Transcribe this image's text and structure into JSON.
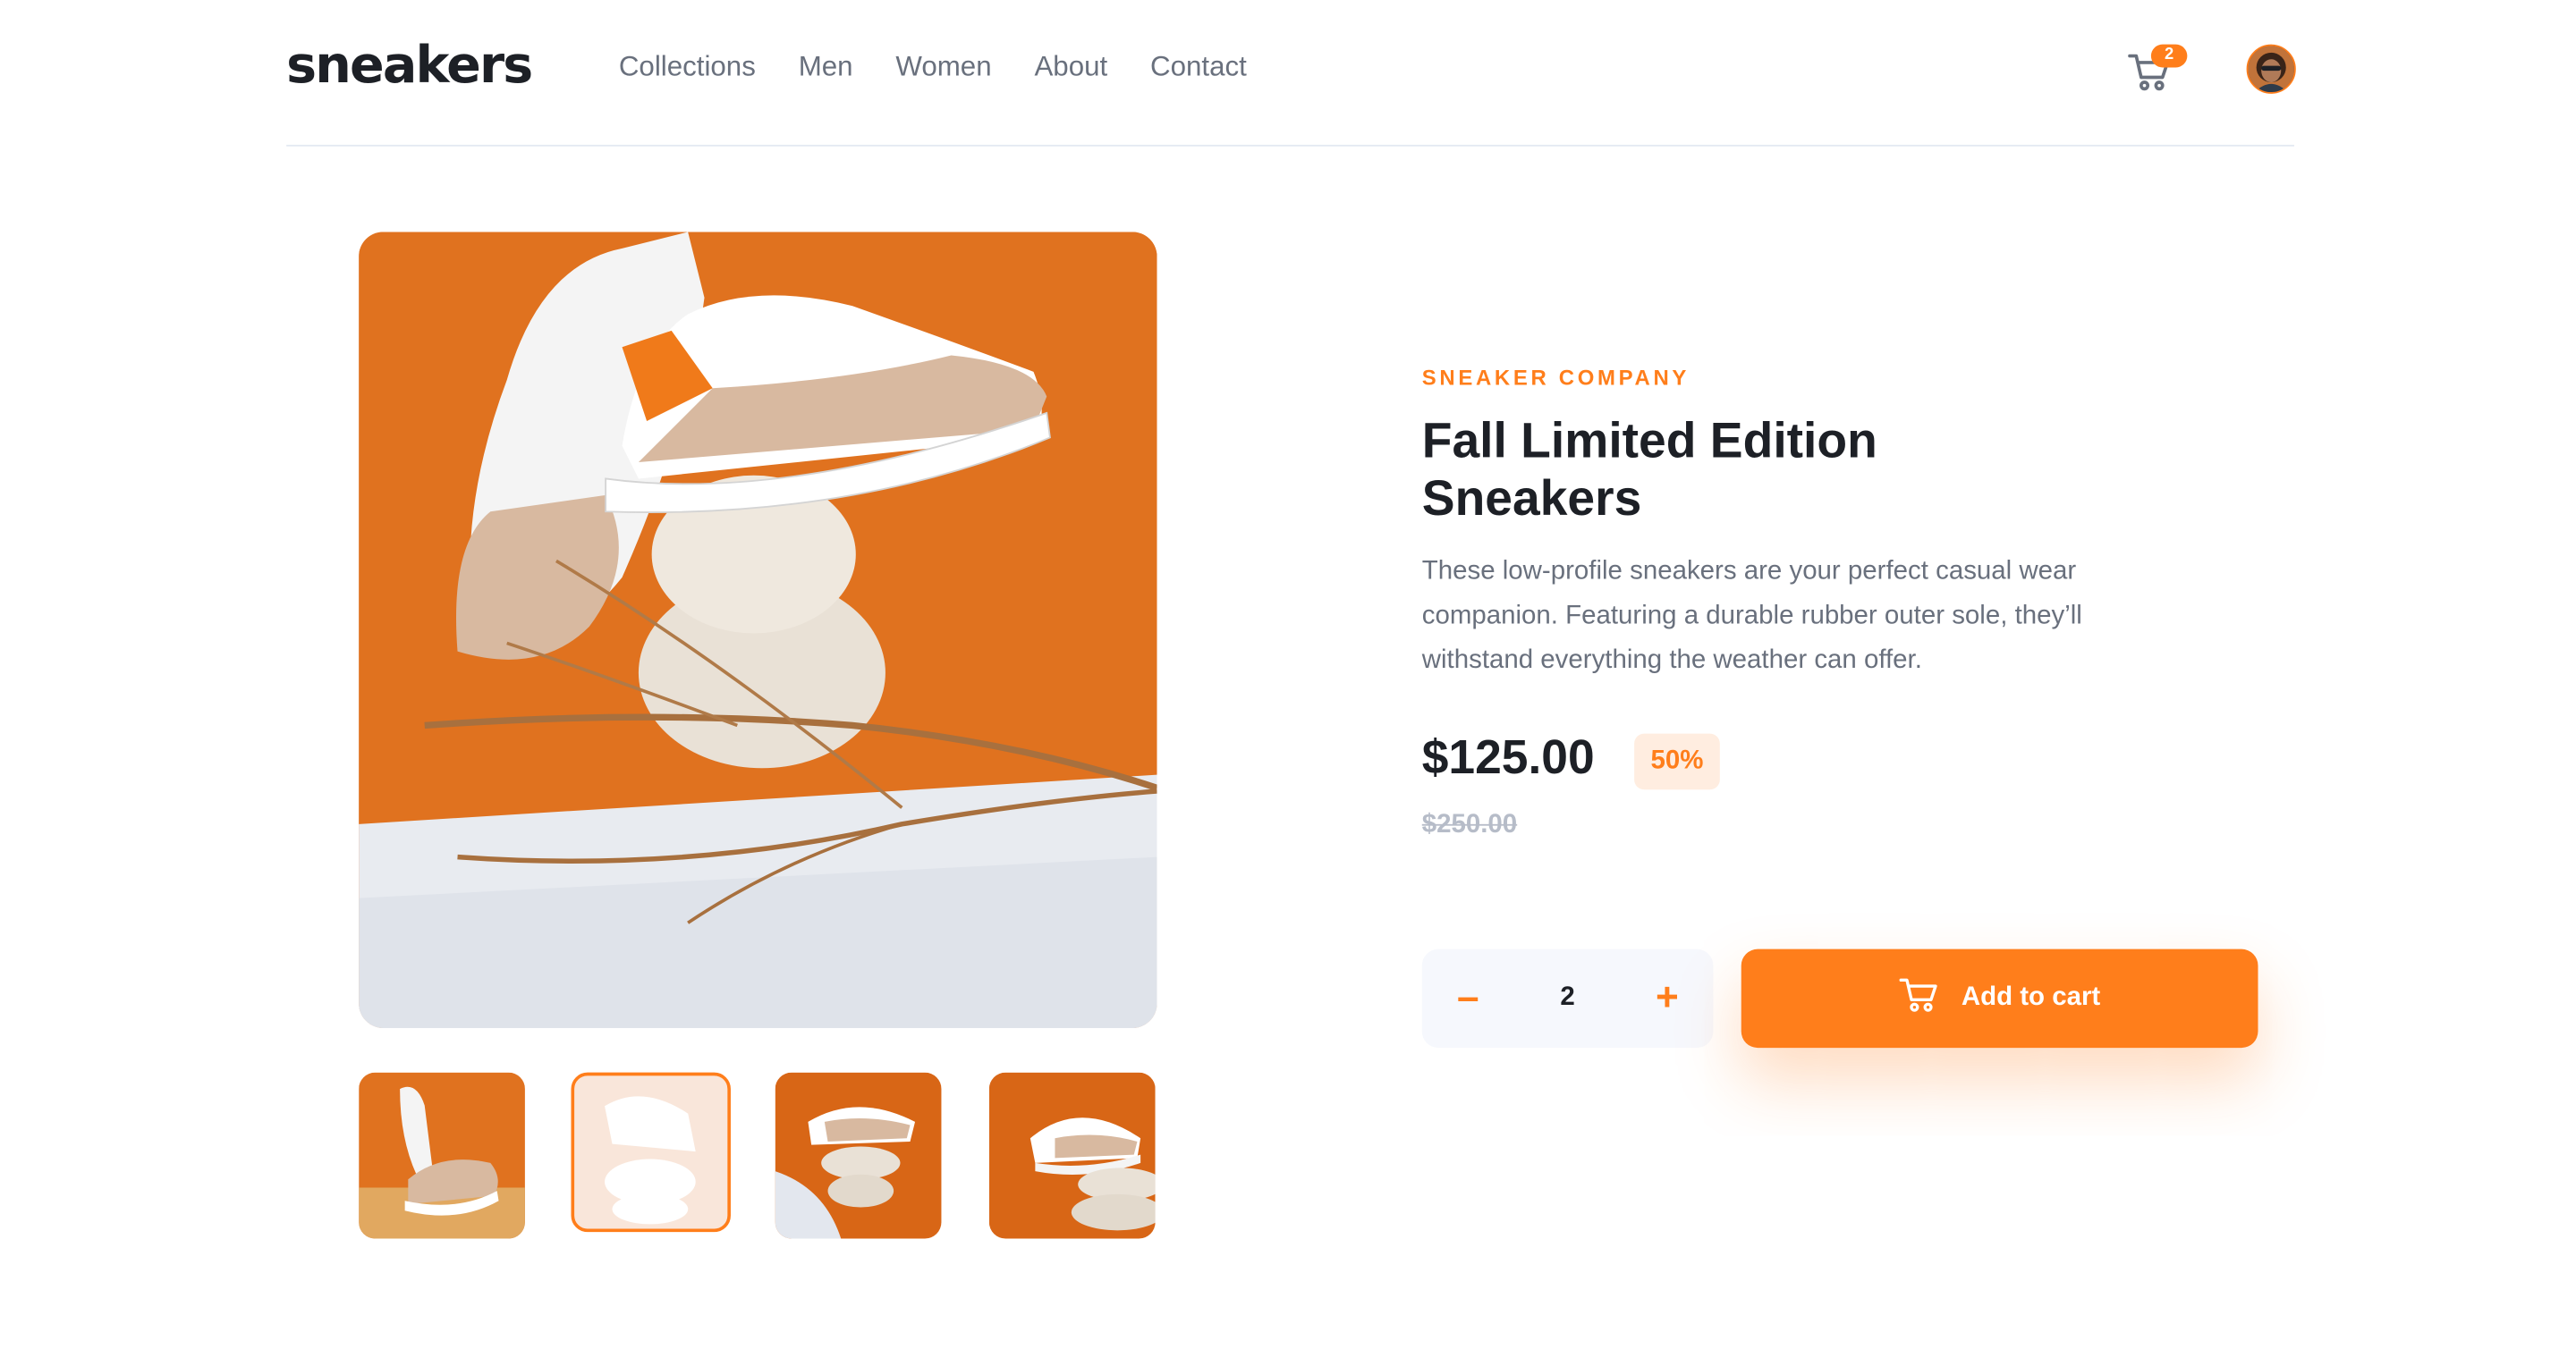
{
  "header": {
    "logo": "sneakers",
    "nav": [
      "Collections",
      "Men",
      "Women",
      "About",
      "Contact"
    ],
    "cart_count": "2",
    "icons": {
      "cart": "cart-icon",
      "avatar": "avatar"
    }
  },
  "product": {
    "company": "SNEAKER COMPANY",
    "title": "Fall Limited Edition Sneakers",
    "description": "These low-profile sneakers are your perfect casual wear companion. Featuring a durable rubber outer sole, they’ll withstand everything the weather can offer.",
    "price": "$125.00",
    "discount": "50%",
    "old_price": "$250.00",
    "quantity": {
      "minus": "–",
      "value": "2",
      "plus": "+"
    },
    "add_to_cart": "Add to cart"
  },
  "gallery": {
    "active_thumbnail": 2,
    "thumbnails": 4
  },
  "colors": {
    "accent": "#ff7e1b",
    "accent_light": "#ffede0",
    "dark": "#1d2026",
    "muted": "#69707d",
    "strike": "#b6bcc8",
    "panel": "#f6f8fd"
  }
}
